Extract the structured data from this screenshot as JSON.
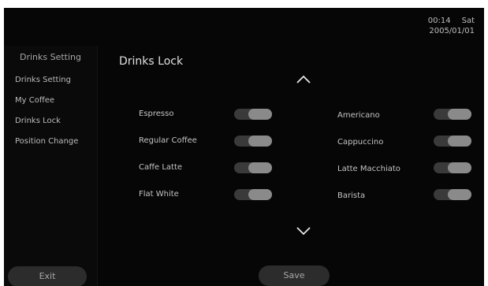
{
  "status": {
    "time": "00:14",
    "day": "Sat",
    "date": "2005/01/01"
  },
  "sidebar": {
    "title": "Drinks Setting",
    "items": [
      {
        "label": "Drinks Setting"
      },
      {
        "label": "My Coffee"
      },
      {
        "label": "Drinks Lock"
      },
      {
        "label": "Position Change"
      }
    ],
    "exit_label": "Exit"
  },
  "main": {
    "title": "Drinks Lock",
    "left_drinks": [
      {
        "label": "Espresso"
      },
      {
        "label": "Regular Coffee"
      },
      {
        "label": "Caffe Latte"
      },
      {
        "label": "Flat White"
      }
    ],
    "right_drinks": [
      {
        "label": "Americano"
      },
      {
        "label": "Cappuccino"
      },
      {
        "label": "Latte Macchiato"
      },
      {
        "label": "Barista"
      }
    ],
    "save_label": "Save"
  },
  "colors": {
    "background": "#060606",
    "toggle_track": "#3a3a3a",
    "toggle_knob": "#8a8a8a",
    "button": "#2c2c2c"
  },
  "icons": {
    "scroll_up": "chevron-up-icon",
    "scroll_down": "chevron-down-icon"
  }
}
